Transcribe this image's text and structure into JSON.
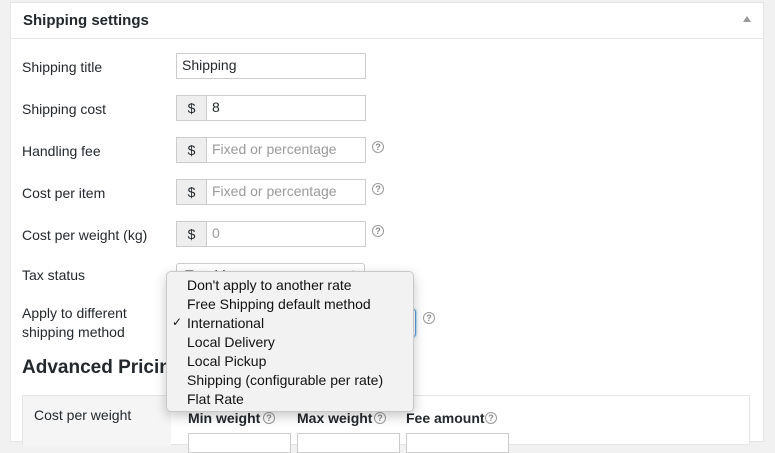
{
  "panel": {
    "title": "Shipping settings"
  },
  "fields": {
    "shipping_title": {
      "label": "Shipping title",
      "value": "Shipping"
    },
    "shipping_cost": {
      "label": "Shipping cost",
      "prefix": "$",
      "value": "8"
    },
    "handling_fee": {
      "label": "Handling fee",
      "prefix": "$",
      "placeholder": "Fixed or percentage"
    },
    "cost_per_item": {
      "label": "Cost per item",
      "prefix": "$",
      "placeholder": "Fixed or percentage"
    },
    "cost_per_weight": {
      "label": "Cost per weight (kg)",
      "prefix": "$",
      "placeholder": "0"
    },
    "tax_status": {
      "label": "Tax status",
      "value": "Taxable"
    },
    "apply_to": {
      "label_line1": "Apply to different",
      "label_line2": "shipping method"
    }
  },
  "help_icon_glyph": "?",
  "dropdown": {
    "options": [
      {
        "label": "Don't apply to another rate",
        "selected": false
      },
      {
        "label": "Free Shipping default method",
        "selected": false
      },
      {
        "label": "International",
        "selected": true
      },
      {
        "label": "Local Delivery",
        "selected": false
      },
      {
        "label": "Local Pickup",
        "selected": false
      },
      {
        "label": "Shipping (configurable per rate)",
        "selected": false
      },
      {
        "label": "Flat Rate",
        "selected": false
      }
    ],
    "check_glyph": "✓"
  },
  "advanced": {
    "heading": "Advanced Pricing",
    "rule_type": "Cost per weight",
    "columns": [
      "Min weight",
      "Max weight",
      "Fee amount"
    ]
  },
  "colors": {
    "accent_focus": "#5b9dd9",
    "addon_bg": "#eeeeee"
  }
}
